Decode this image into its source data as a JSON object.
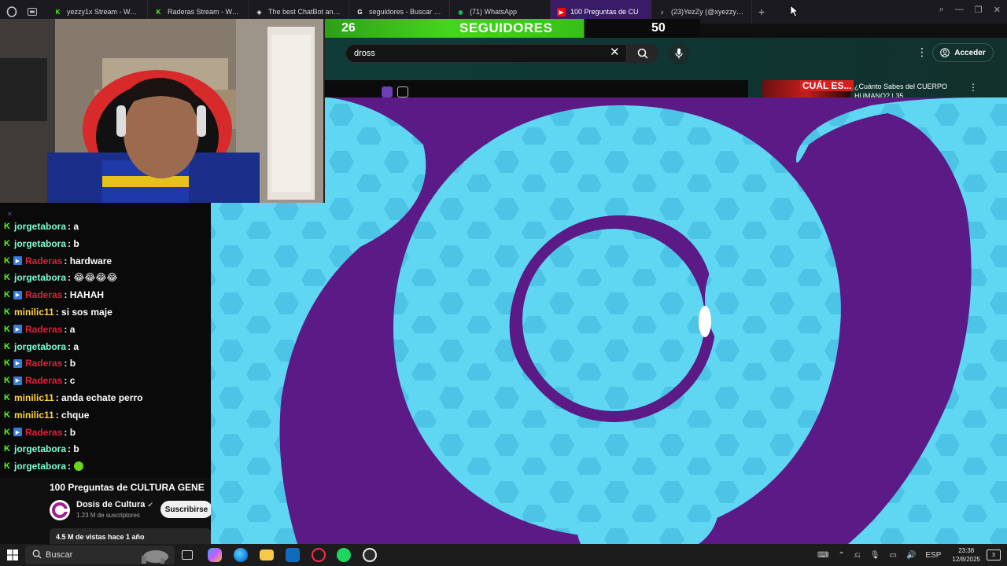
{
  "tabs": [
    {
      "label": "yezzy1x Stream - Watch L",
      "favicon": "kick-icon",
      "color": "#53fc18"
    },
    {
      "label": "Raderas Stream - Watch L",
      "favicon": "kick-icon",
      "color": "#53fc18"
    },
    {
      "label": "The best ChatBot and Wi",
      "favicon": "bot-icon",
      "color": "#ffffff"
    },
    {
      "label": "seguidores - Buscar con",
      "favicon": "google-icon",
      "color": "#ffffff"
    },
    {
      "label": "(71) WhatsApp",
      "favicon": "whatsapp-icon",
      "color": "#25d366"
    },
    {
      "label": "100 Preguntas de CU",
      "favicon": "youtube-icon",
      "color": "#ff0000",
      "active": true
    },
    {
      "label": "(23)YezZy (@xyezzyy) | T",
      "favicon": "tiktok-icon",
      "color": "#ffffff"
    }
  ],
  "new_tab": "+",
  "followers": {
    "current": "26",
    "label": "SEGUIDORES",
    "goal": "50",
    "progress_fraction": 0.52
  },
  "youtube": {
    "search_value": "dross",
    "login_label": "Acceder",
    "rec_thumb_text": "CUÁL ES...",
    "rec_title": "¿Cuánto Sabes del CUERPO HUMANO?",
    "rec_meta": "| 35"
  },
  "chat": [
    {
      "user": "jorgetabora",
      "color": "#7fffd4",
      "msg": ": a",
      "twitch": false
    },
    {
      "user": "jorgetabora",
      "color": "#7fffd4",
      "msg": ": b",
      "twitch": false
    },
    {
      "user": "Raderas",
      "color": "#e0203a",
      "msg": ": hardware",
      "twitch": true
    },
    {
      "user": "jorgetabora",
      "color": "#7fffd4",
      "msg": ": 😂😂😂😂",
      "twitch": false
    },
    {
      "user": "Raderas",
      "color": "#e0203a",
      "msg": ": HAHAH",
      "twitch": true
    },
    {
      "user": "minilic11",
      "color": "#ffd23a",
      "msg": ": si sos maje",
      "twitch": false
    },
    {
      "user": "Raderas",
      "color": "#e0203a",
      "msg": ": a",
      "twitch": true
    },
    {
      "user": "jorgetabora",
      "color": "#7fffd4",
      "msg": ": a",
      "twitch": false
    },
    {
      "user": "Raderas",
      "color": "#e0203a",
      "msg": ": b",
      "twitch": true
    },
    {
      "user": "Raderas",
      "color": "#e0203a",
      "msg": ": c",
      "twitch": true
    },
    {
      "user": "minilic11",
      "color": "#ffd23a",
      "msg": ": anda echate perro",
      "twitch": false
    },
    {
      "user": "minilic11",
      "color": "#ffd23a",
      "msg": ": chque",
      "twitch": false
    },
    {
      "user": "Raderas",
      "color": "#e0203a",
      "msg": ": b",
      "twitch": true
    },
    {
      "user": "jorgetabora",
      "color": "#7fffd4",
      "msg": ": b",
      "twitch": false
    },
    {
      "user": "jorgetabora",
      "color": "#7fffd4",
      "msg": ":",
      "twitch": false,
      "emote": true
    }
  ],
  "video": {
    "title": "100 Preguntas de CULTURA GENE",
    "channel": "Dosis de Cultura",
    "subscribers": "1.23 M de suscriptores",
    "subscribe_label": "Suscribirse",
    "views": "4.5 M de vistas  hace 1 año"
  },
  "taskbar": {
    "search_label": "Buscar",
    "language": "ESP",
    "time": "23:38",
    "date": "12/8/2025",
    "notifications": "3"
  },
  "colors": {
    "purple": "#5b1a86",
    "cyan": "#55d4f0",
    "kick_green": "#53fc18"
  }
}
